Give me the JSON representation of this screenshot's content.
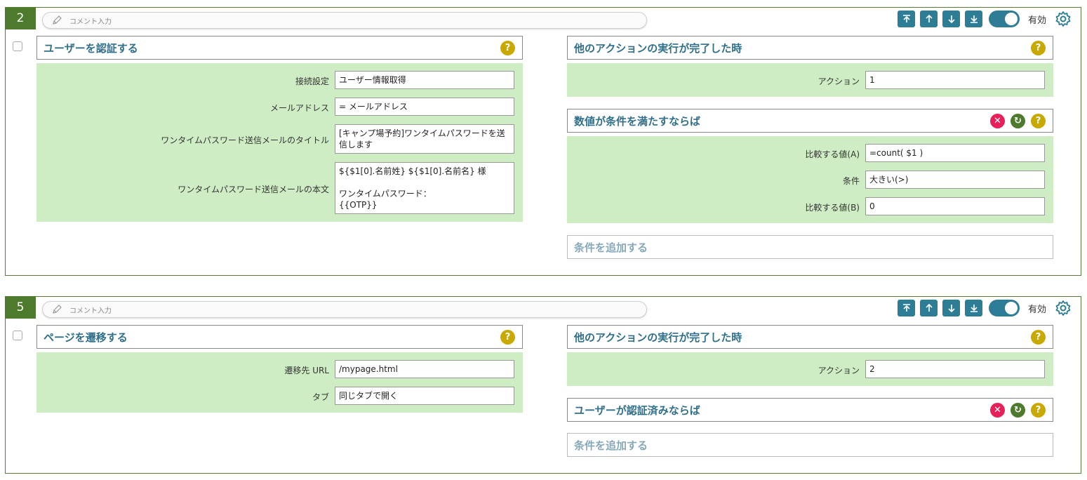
{
  "common": {
    "comment_placeholder": "コメント入力",
    "enabled_label": "有効",
    "add_condition": "条件を追加する"
  },
  "step1": {
    "number": "2",
    "action_title": "ユーザーを認証する",
    "fields": [
      {
        "label": "接続設定",
        "value": "ユーザー情報取得"
      },
      {
        "label": "メールアドレス",
        "value": "= メールアドレス"
      },
      {
        "label": "ワンタイムパスワード送信メールのタイトル",
        "value": "[キャンプ場予約]ワンタイムパスワードを送\n信します"
      },
      {
        "label": "ワンタイムパスワード送信メールの本文",
        "value": "${$1[0].名前姓} ${$1[0].名前名} 様\n\nワンタイムパスワード：\n{{OTP}}"
      }
    ],
    "trigger_title": "他のアクションの実行が完了した時",
    "trigger_fields": [
      {
        "label": "アクション",
        "value": "1"
      }
    ],
    "condition_title": "数値が条件を満たすならば",
    "condition_fields": [
      {
        "label": "比較する値(A)",
        "value": "=count( $1 )"
      },
      {
        "label": "条件",
        "value": "大きい(>)"
      },
      {
        "label": "比較する値(B)",
        "value": "0"
      }
    ]
  },
  "step2": {
    "number": "5",
    "action_title": "ページを遷移する",
    "fields": [
      {
        "label": "遷移先 URL",
        "value": "/mypage.html"
      },
      {
        "label": "タブ",
        "value": "同じタブで開く"
      }
    ],
    "trigger_title": "他のアクションの実行が完了した時",
    "trigger_fields": [
      {
        "label": "アクション",
        "value": "2"
      }
    ],
    "condition_title": "ユーザーが認証済みならば"
  },
  "icons": [
    "pencil-icon",
    "move-top-icon",
    "move-up-icon",
    "move-down-icon",
    "move-bottom-icon",
    "gear-icon",
    "help-icon",
    "delete-icon",
    "refresh-icon"
  ],
  "colors": {
    "accent": "#2d7d96",
    "step_number_bg": "#4e7a2e",
    "panel_bg": "#cfedc4",
    "help": "#c9a800",
    "delete": "#e8205a",
    "title_text": "#2f6f8a"
  }
}
